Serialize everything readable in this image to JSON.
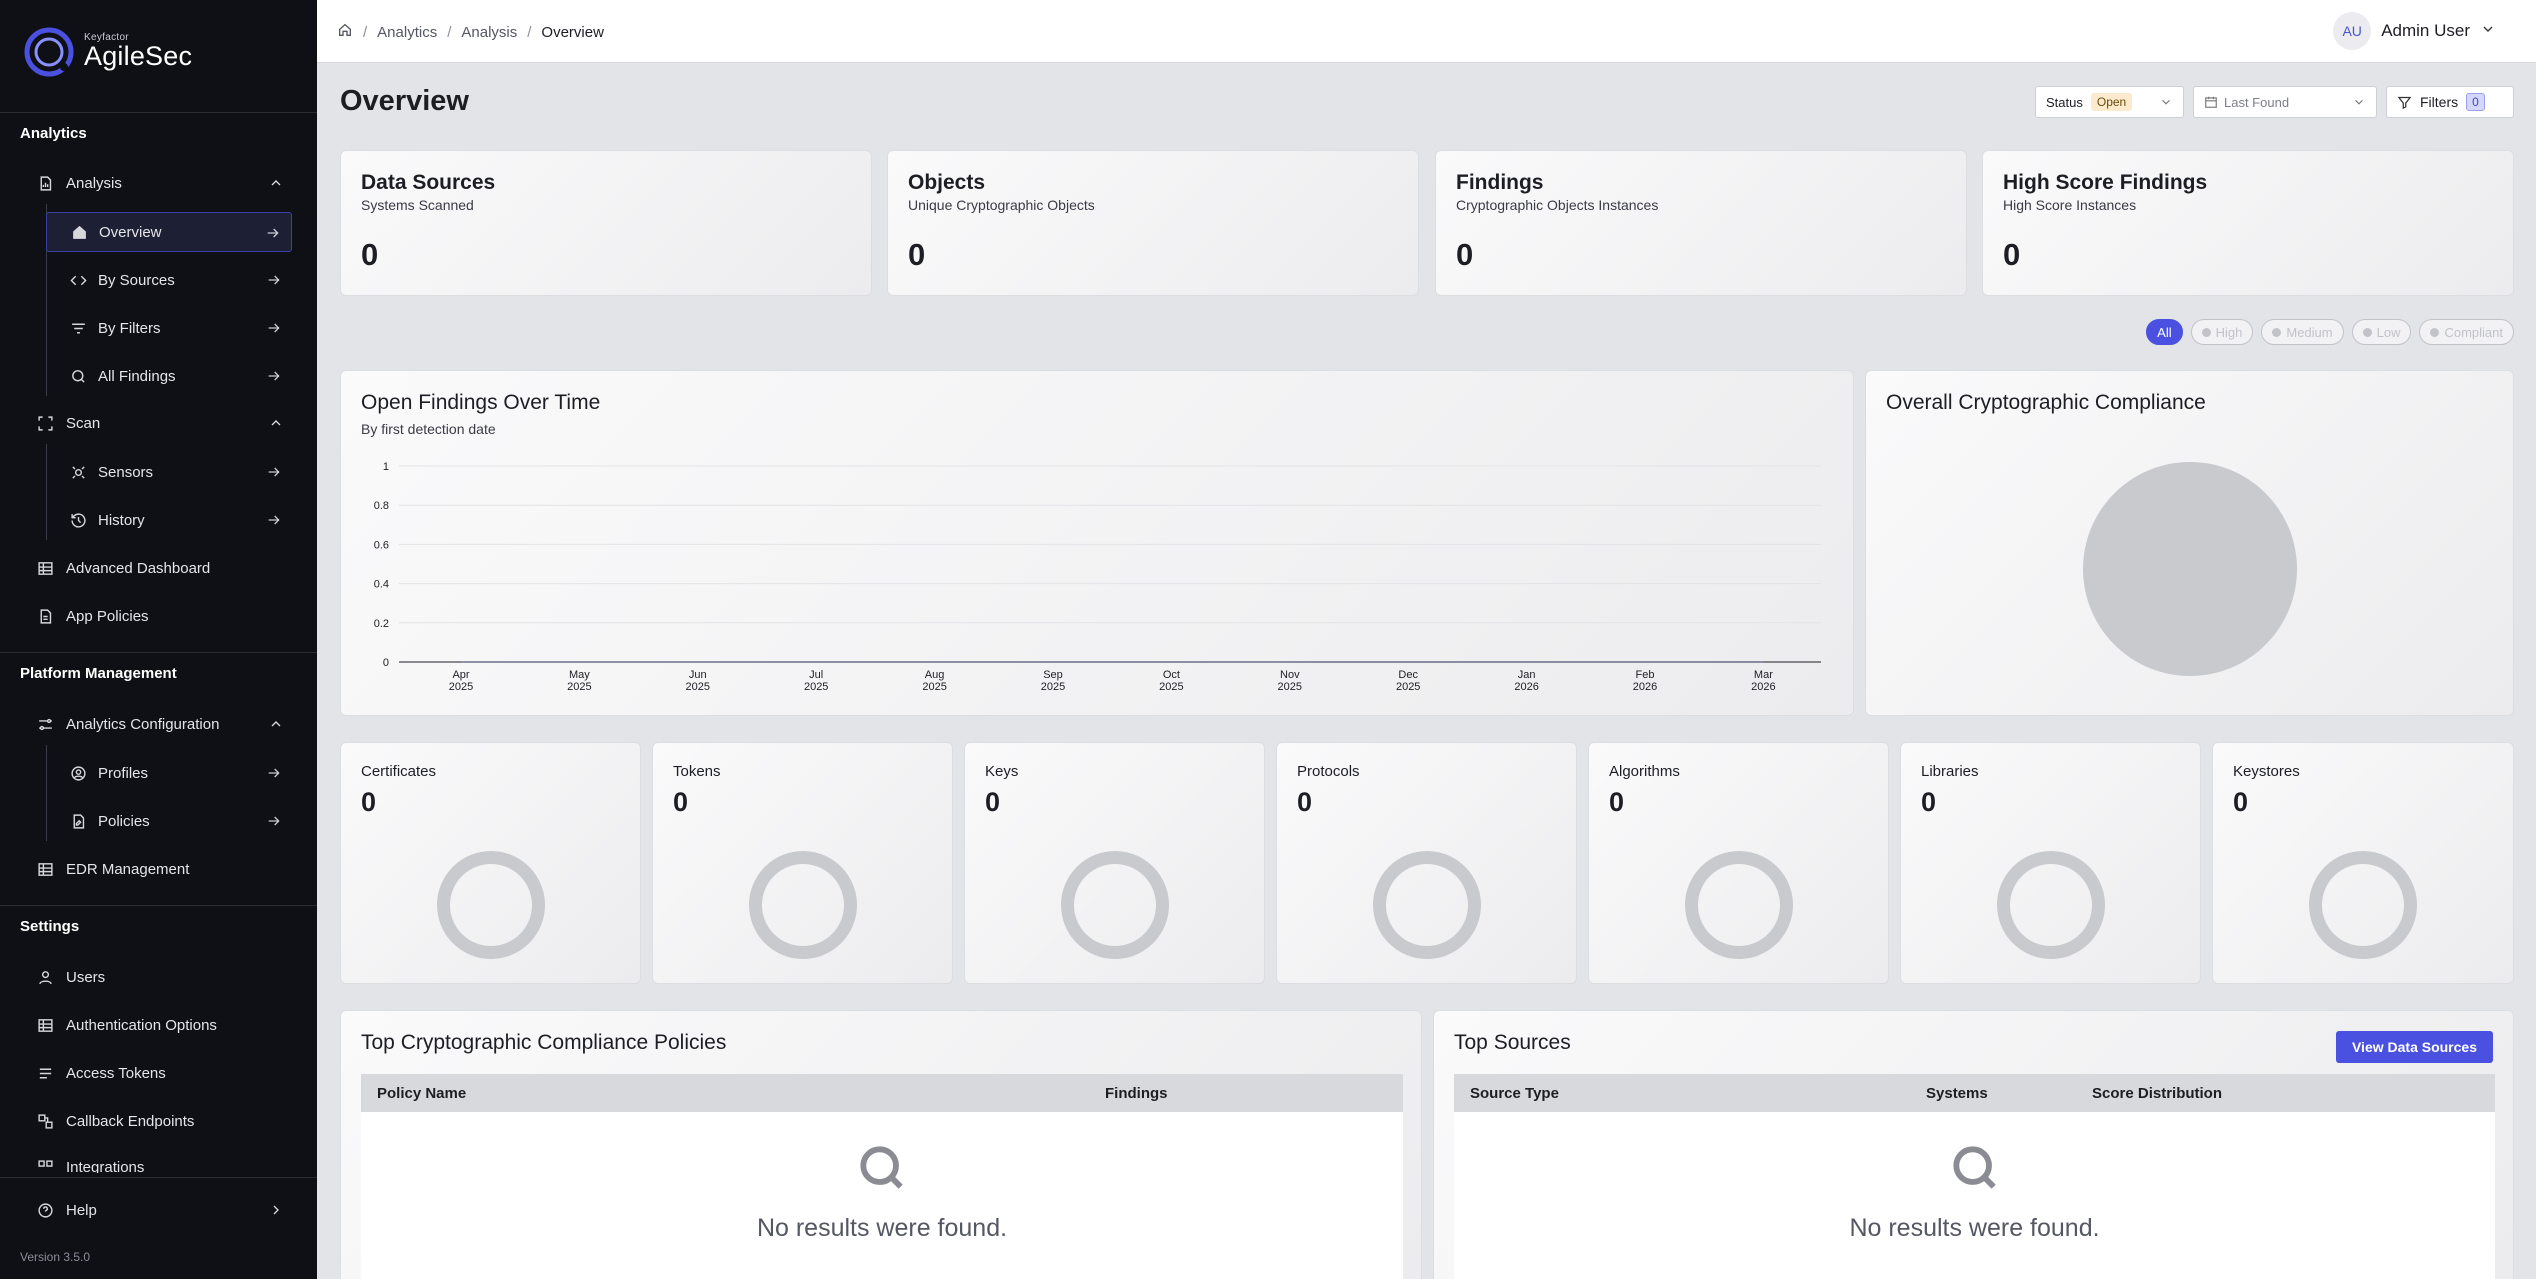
{
  "brand": {
    "small": "Keyfactor",
    "name": "AgileSec"
  },
  "sidebar": {
    "sections": {
      "analytics": "Analytics",
      "platform": "Platform Management",
      "settings": "Settings"
    },
    "analysis": "Analysis",
    "analysis_items": [
      "Overview",
      "By Sources",
      "By Filters",
      "All Findings"
    ],
    "scan": "Scan",
    "scan_items": [
      "Sensors",
      "History"
    ],
    "advanced_dashboard": "Advanced Dashboard",
    "app_policies": "App Policies",
    "analytics_configuration": "Analytics Configuration",
    "config_items": [
      "Profiles",
      "Policies"
    ],
    "edr_management": "EDR Management",
    "settings_items": [
      "Users",
      "Authentication Options",
      "Access Tokens",
      "Callback Endpoints",
      "Integrations"
    ],
    "help": "Help",
    "version": "Version 3.5.0"
  },
  "topbar": {
    "breadcrumb": [
      "Analytics",
      "Analysis",
      "Overview"
    ],
    "user_initials": "AU",
    "user_name": "Admin User"
  },
  "page": {
    "title": "Overview",
    "status_label": "Status",
    "status_value": "Open",
    "date_placeholder": "Last Found",
    "filters_label": "Filters",
    "filters_count": "0"
  },
  "stats": [
    {
      "title": "Data Sources",
      "sub": "Systems Scanned",
      "value": "0"
    },
    {
      "title": "Objects",
      "sub": "Unique Cryptographic Objects",
      "value": "0"
    },
    {
      "title": "Findings",
      "sub": "Cryptographic Objects Instances",
      "value": "0"
    },
    {
      "title": "High Score Findings",
      "sub": "High Score Instances",
      "value": "0"
    }
  ],
  "severity_pills": [
    "All",
    "High",
    "Medium",
    "Low",
    "Compliant"
  ],
  "findings_chart": {
    "title": "Open Findings Over Time",
    "subtitle": "By first detection date"
  },
  "compliance": {
    "title": "Overall Cryptographic Compliance"
  },
  "chart_data": {
    "type": "line",
    "y_ticks": [
      "0",
      "0.2",
      "0.4",
      "0.6",
      "0.8",
      "1"
    ],
    "ylim": [
      0,
      1
    ],
    "x_months": [
      "Apr",
      "May",
      "Jun",
      "Jul",
      "Aug",
      "Sep",
      "Oct",
      "Nov",
      "Dec",
      "Jan",
      "Feb",
      "Mar"
    ],
    "x_years": [
      "2025",
      "2025",
      "2025",
      "2025",
      "2025",
      "2025",
      "2025",
      "2025",
      "2025",
      "2026",
      "2026",
      "2026"
    ],
    "values": [
      0,
      0,
      0,
      0,
      0,
      0,
      0,
      0,
      0,
      0,
      0,
      0
    ]
  },
  "minis": [
    {
      "title": "Certificates",
      "value": "0"
    },
    {
      "title": "Tokens",
      "value": "0"
    },
    {
      "title": "Keys",
      "value": "0"
    },
    {
      "title": "Protocols",
      "value": "0"
    },
    {
      "title": "Algorithms",
      "value": "0"
    },
    {
      "title": "Libraries",
      "value": "0"
    },
    {
      "title": "Keystores",
      "value": "0"
    }
  ],
  "policies_table": {
    "title": "Top Cryptographic Compliance Policies",
    "columns": [
      "Policy Name",
      "Findings"
    ],
    "empty": "No results were found."
  },
  "sources_table": {
    "title": "Top Sources",
    "button": "View Data Sources",
    "columns": [
      "Source Type",
      "Systems",
      "Score Distribution"
    ],
    "empty": "No results were found."
  },
  "colors": {
    "accent": "#4a51e0",
    "sidebar_bg": "#0e1016"
  }
}
